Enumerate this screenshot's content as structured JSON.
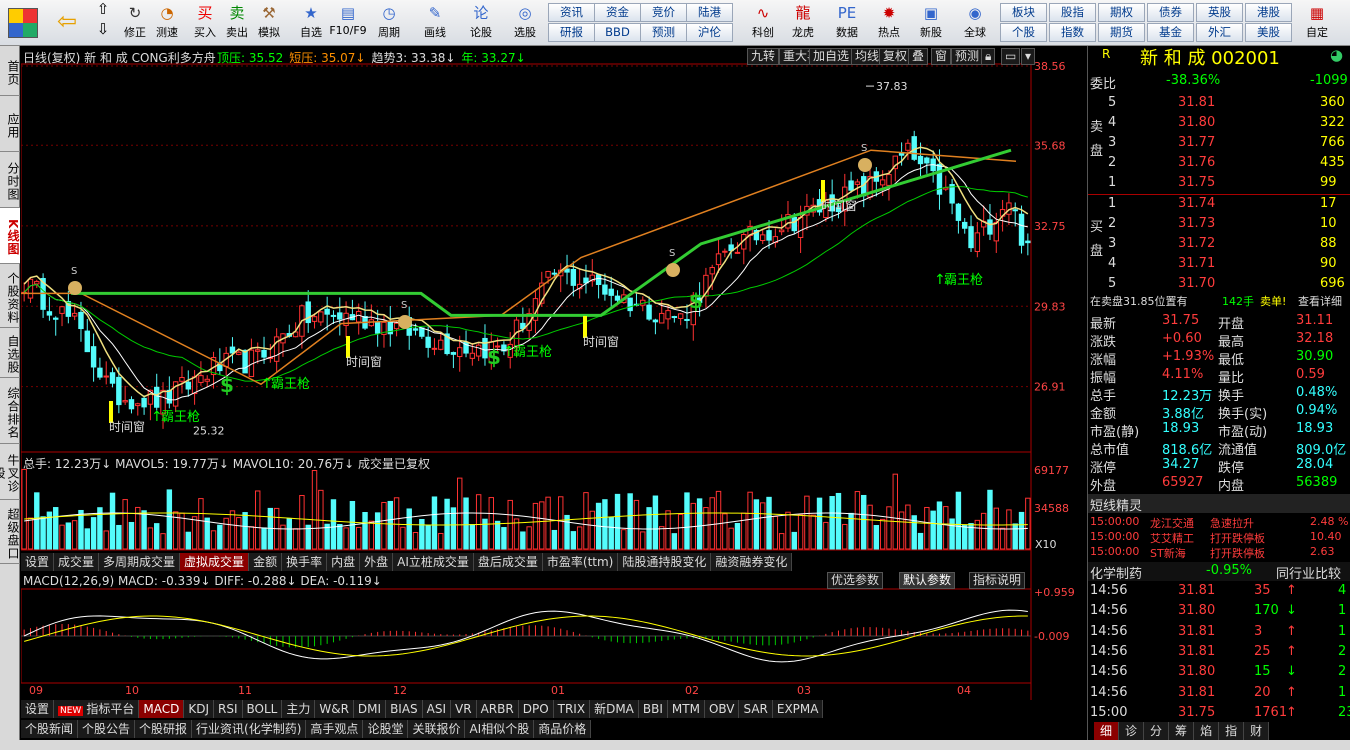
{
  "toolbar": {
    "items": [
      {
        "label": "修正",
        "icon": "back-arrow-icon"
      },
      {
        "label": "测速",
        "icon": "speed-icon"
      },
      {
        "label": "买入",
        "icon": "buy-icon"
      },
      {
        "label": "卖出",
        "icon": "sell-icon"
      },
      {
        "label": "模拟",
        "icon": "hammer-icon"
      },
      {
        "label": "自选",
        "icon": "star-icon"
      },
      {
        "label": "F10/F9",
        "icon": "f10-icon"
      },
      {
        "label": "周期",
        "icon": "clock-icon"
      },
      {
        "label": "画线",
        "icon": "pencil-icon"
      },
      {
        "label": "论股",
        "icon": "chat-icon"
      },
      {
        "label": "选股",
        "icon": "select-icon"
      },
      {
        "label": "科创",
        "icon": "tech-icon"
      },
      {
        "label": "龙虎",
        "icon": "dragon-icon"
      },
      {
        "label": "数据",
        "icon": "data-icon"
      },
      {
        "label": "热点",
        "icon": "hot-icon"
      },
      {
        "label": "新股",
        "icon": "ipo-icon"
      },
      {
        "label": "全球",
        "icon": "globe-icon"
      },
      {
        "label": "自定",
        "icon": "custom-icon"
      }
    ],
    "grid_buttons": [
      [
        "资讯",
        "资金",
        "竞价",
        "陆港"
      ],
      [
        "研报",
        "BBD",
        "预测",
        "沪伦"
      ]
    ],
    "right_buttons": [
      [
        "板块",
        "股指",
        "期权",
        "债券",
        "英股",
        "港股"
      ],
      [
        "个股",
        "指数",
        "期货",
        "基金",
        "外汇",
        "美股"
      ]
    ]
  },
  "left_nav": [
    "首页",
    "应用",
    "分时图",
    "K线图",
    "个股资料",
    "自选股",
    "综合排名",
    "牛叉诊股",
    "超级盘口"
  ],
  "main": {
    "title": "日线(复权) 新 和 成 CONG利多方舟",
    "indicators": [
      {
        "label": "顶压: 35.52",
        "color": "#0f0"
      },
      {
        "label": "短压: 35.07↓",
        "color": "#ff9000"
      },
      {
        "label": "趋势3: 33.38↓",
        "color": "#ddd"
      },
      {
        "label": "年: 33.27↓",
        "color": "#0f0"
      }
    ],
    "controls": [
      "九转",
      "重大事件",
      "加自选",
      "均线",
      "复权",
      "叠",
      "窗",
      "预测"
    ],
    "y_ticks": [
      "38.56",
      "35.68",
      "32.75",
      "29.83",
      "26.91"
    ],
    "high_label": "37.83",
    "low_label": "25.32",
    "annotations": [
      "时间窗",
      "霸王枪",
      "S"
    ]
  },
  "volume": {
    "title": "总手: 12.23万↓ MAVOL5: 19.77万↓ MAVOL10: 20.76万↓ 成交量已复权",
    "y_ticks": [
      "69177",
      "34588"
    ],
    "unit": "X10",
    "tabs": [
      "设置",
      "成交量",
      "多周期成交量",
      "虚拟成交量",
      "金额",
      "换手率",
      "内盘",
      "外盘",
      "AI立桩成交量",
      "盘后成交量",
      "市盈率(ttm)",
      "陆股通持股变化",
      "融资融券变化"
    ]
  },
  "macd": {
    "title": "MACD(12,26,9) MACD: -0.339↓ DIFF: -0.288↓ DEA: -0.119↓",
    "buttons": [
      "优选参数",
      "默认参数",
      "指标说明"
    ],
    "y_ticks": [
      "+0.959",
      "-0.009"
    ]
  },
  "x_axis": [
    "09",
    "10",
    "11",
    "12",
    "01",
    "02",
    "03",
    "04"
  ],
  "indicator_tabs": [
    "设置",
    "指标平台",
    "MACD",
    "KDJ",
    "RSI",
    "BOLL",
    "主力",
    "W&R",
    "DMI",
    "BIAS",
    "ASI",
    "VR",
    "ARBR",
    "DPO",
    "TRIX",
    "新DMA",
    "BBI",
    "MTM",
    "OBV",
    "SAR",
    "EXPMA"
  ],
  "bottom_tabs": [
    "个股新闻",
    "个股公告",
    "个股研报",
    "行业资讯(化学制药)",
    "高手观点",
    "论股堂",
    "关联报价",
    "AI相似个股",
    "商品价格"
  ],
  "right": {
    "stock": "新 和 成 002001",
    "webi": "-38.36%",
    "webi_diff": "-1099",
    "sell": [
      [
        "5",
        "31.81",
        "360"
      ],
      [
        "4",
        "31.80",
        "322"
      ],
      [
        "3",
        "31.77",
        "766"
      ],
      [
        "2",
        "31.76",
        "435"
      ],
      [
        "1",
        "31.75",
        "99"
      ]
    ],
    "buy": [
      [
        "1",
        "31.74",
        "17"
      ],
      [
        "2",
        "31.73",
        "10"
      ],
      [
        "3",
        "31.72",
        "88"
      ],
      [
        "4",
        "31.71",
        "90"
      ],
      [
        "5",
        "31.70",
        "696"
      ]
    ],
    "order_note": "在卖盘31.85位置有",
    "order_qty": "142手",
    "order_label": "卖单!",
    "order_link": "查看详细",
    "quote": [
      [
        "最新",
        "31.75",
        "开盘",
        "31.11"
      ],
      [
        "涨跌",
        "+0.60",
        "最高",
        "32.18"
      ],
      [
        "涨幅",
        "+1.93%",
        "最低",
        "30.90"
      ],
      [
        "振幅",
        "4.11%",
        "量比",
        "0.59"
      ],
      [
        "总手",
        "12.23万",
        "换手",
        "0.48%"
      ],
      [
        "金额",
        "3.88亿",
        "换手(实)",
        "0.94%"
      ],
      [
        "市盈(静)",
        "18.93",
        "市盈(动)",
        "18.93"
      ],
      [
        "总市值",
        "818.6亿",
        "流通值",
        "809.0亿"
      ],
      [
        "涨停",
        "34.27",
        "跌停",
        "28.04"
      ],
      [
        "外盘",
        "65927",
        "内盘",
        "56389"
      ]
    ],
    "news_title": "短线精灵",
    "news": [
      [
        "15:00:00",
        "龙江交通",
        "急速拉升",
        "2.48 %"
      ],
      [
        "15:00:00",
        "艾艾精工",
        "打开跌停板",
        "10.40"
      ],
      [
        "15:00:00",
        "ST新海",
        "打开跌停板",
        "2.63"
      ]
    ],
    "industry": "化学制药",
    "industry_pct": "-0.95%",
    "industry_btn": "同行业比较",
    "ticks": [
      [
        "14:56",
        "31.81",
        "35",
        "↑",
        "4"
      ],
      [
        "14:56",
        "31.80",
        "170",
        "↓",
        "1"
      ],
      [
        "14:56",
        "31.81",
        "3",
        "↑",
        "1"
      ],
      [
        "14:56",
        "31.81",
        "25",
        "↑",
        "2"
      ],
      [
        "14:56",
        "31.80",
        "15",
        "↓",
        "2"
      ],
      [
        "14:56",
        "31.81",
        "20",
        "↑",
        "1"
      ],
      [
        "15:00",
        "31.75",
        "1761",
        "↑",
        "23"
      ]
    ],
    "bottom_tabs": [
      "细",
      "诊",
      "分",
      "筹",
      "焰",
      "指",
      "财"
    ]
  }
}
